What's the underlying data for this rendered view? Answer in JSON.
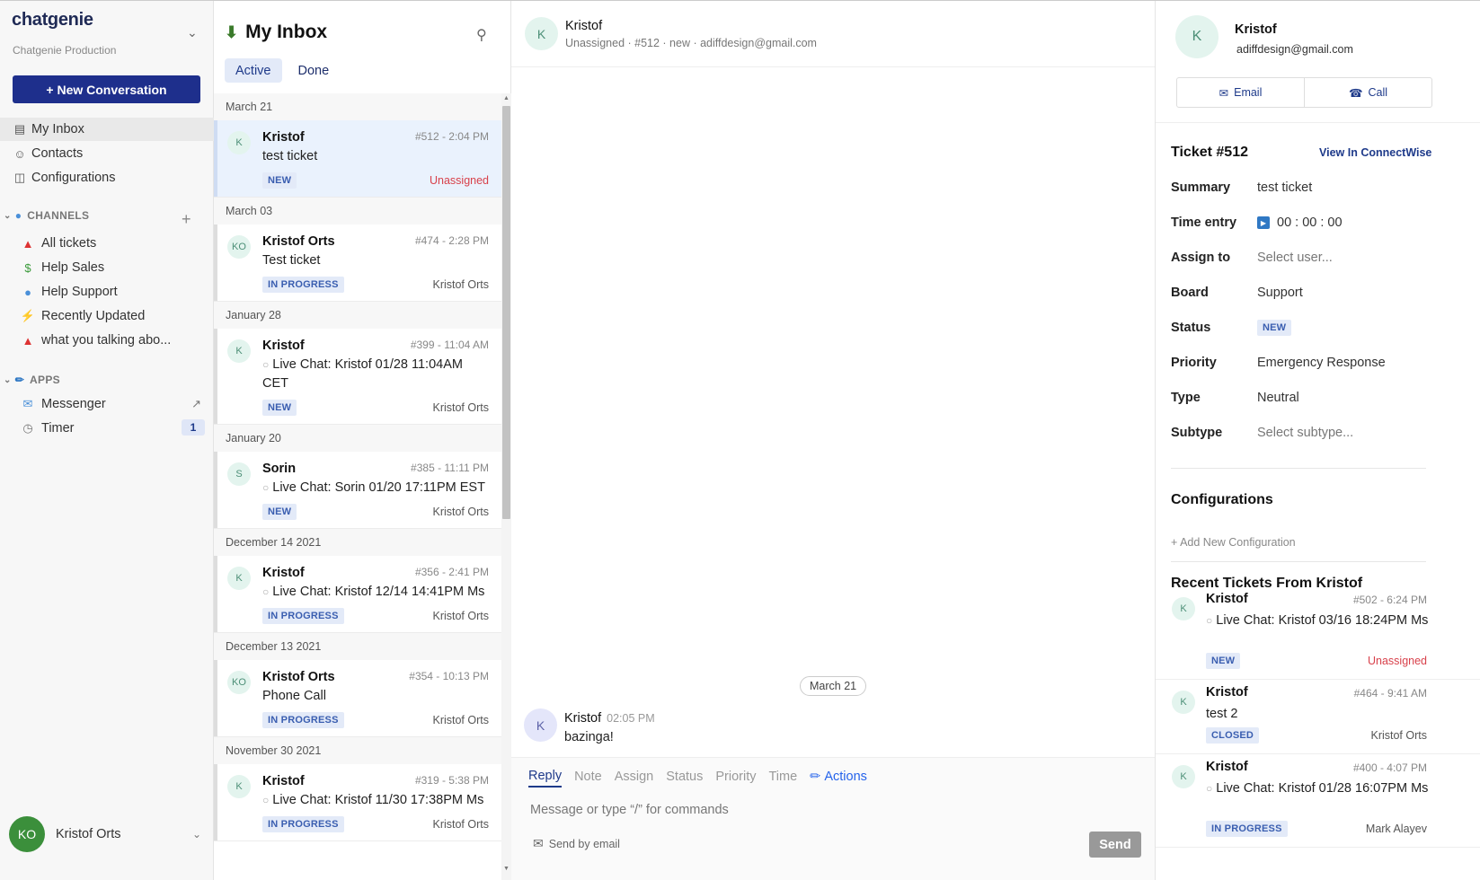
{
  "sidebar": {
    "brand": "chatgenie",
    "workspace": "Chatgenie Production",
    "new_button": "+ New Conversation",
    "nav": [
      {
        "label": "My Inbox",
        "icon": "inbox-icon"
      },
      {
        "label": "Contacts",
        "icon": "contacts-icon"
      },
      {
        "label": "Configurations",
        "icon": "monitor-icon"
      }
    ],
    "channels_header": "CHANNELS",
    "channels": [
      {
        "label": "All tickets",
        "icon": "siren-icon"
      },
      {
        "label": "Help Sales",
        "icon": "money-icon"
      },
      {
        "label": "Help Support",
        "icon": "speech-bubble-icon"
      },
      {
        "label": "Recently Updated",
        "icon": "lightning-icon"
      },
      {
        "label": "what you talking abo...",
        "icon": "siren-icon"
      }
    ],
    "apps_header": "APPS",
    "apps": [
      {
        "label": "Messenger",
        "icon": "messenger-icon"
      },
      {
        "label": "Timer",
        "icon": "clock-icon",
        "badge": "1"
      }
    ],
    "user": {
      "initials": "KO",
      "name": "Kristof Orts"
    }
  },
  "inbox": {
    "title": "My Inbox",
    "tabs": [
      "Active",
      "Done"
    ],
    "groups": [
      {
        "date": "March 21",
        "items": [
          {
            "initials": "K",
            "name": "Kristof",
            "meta": "#512 - 2:04 PM",
            "subject": "test ticket",
            "chat": false,
            "status": "NEW",
            "assignee": "Unassigned",
            "unassigned": true,
            "selected": true
          }
        ]
      },
      {
        "date": "March 03",
        "items": [
          {
            "initials": "KO",
            "name": "Kristof Orts",
            "meta": "#474 - 2:28 PM",
            "subject": "Test ticket",
            "chat": false,
            "status": "IN PROGRESS",
            "assignee": "Kristof Orts"
          }
        ]
      },
      {
        "date": "January 28",
        "items": [
          {
            "initials": "K",
            "name": "Kristof",
            "meta": "#399 - 11:04 AM",
            "subject": "Live Chat: Kristof 01/28 11:04AM CET",
            "chat": true,
            "status": "NEW",
            "assignee": "Kristof Orts"
          }
        ]
      },
      {
        "date": "January 20",
        "items": [
          {
            "initials": "S",
            "name": "Sorin",
            "meta": "#385 - 11:11 PM",
            "subject": "Live Chat: Sorin 01/20 17:11PM EST",
            "chat": true,
            "status": "NEW",
            "assignee": "Kristof Orts"
          }
        ]
      },
      {
        "date": "December 14 2021",
        "items": [
          {
            "initials": "K",
            "name": "Kristof",
            "meta": "#356 - 2:41 PM",
            "subject": "Live Chat: Kristof 12/14 14:41PM Ms",
            "chat": true,
            "status": "IN PROGRESS",
            "assignee": "Kristof Orts"
          }
        ]
      },
      {
        "date": "December 13 2021",
        "items": [
          {
            "initials": "KO",
            "name": "Kristof Orts",
            "meta": "#354 - 10:13 PM",
            "subject": "Phone Call",
            "chat": false,
            "status": "IN PROGRESS",
            "assignee": "Kristof Orts"
          }
        ]
      },
      {
        "date": "November 30 2021",
        "items": [
          {
            "initials": "K",
            "name": "Kristof",
            "meta": "#319 - 5:38 PM",
            "subject": "Live Chat: Kristof 11/30 17:38PM Ms",
            "chat": true,
            "status": "IN PROGRESS",
            "assignee": "Kristof Orts"
          }
        ]
      }
    ]
  },
  "chat": {
    "header_initials": "K",
    "header_name": "Kristof",
    "header_sub": "Unassigned · #512 · new · adiffdesign@gmail.com",
    "date_pill": "March 21",
    "message": {
      "initials": "K",
      "name": "Kristof",
      "time": "02:05 PM",
      "text": "bazinga!"
    },
    "composer_tabs": [
      "Reply",
      "Note",
      "Assign",
      "Status",
      "Priority",
      "Time"
    ],
    "actions_label": "Actions",
    "placeholder": "Message or type “/” for commands",
    "send_by_email": "Send by email",
    "send": "Send"
  },
  "details": {
    "initials": "K",
    "name": "Kristof",
    "email": "adiffdesign@gmail.com",
    "email_btn": "Email",
    "call_btn": "Call",
    "ticket_title": "Ticket #512",
    "view_link": "View In ConnectWise",
    "fields": {
      "summary": {
        "label": "Summary",
        "value": "test ticket"
      },
      "time_entry": {
        "label": "Time entry",
        "value": "00 : 00 : 00"
      },
      "assign_to": {
        "label": "Assign to",
        "value": "Select user..."
      },
      "board": {
        "label": "Board",
        "value": "Support"
      },
      "status": {
        "label": "Status",
        "value": "NEW"
      },
      "priority": {
        "label": "Priority",
        "value": "Emergency Response"
      },
      "type": {
        "label": "Type",
        "value": "Neutral"
      },
      "subtype": {
        "label": "Subtype",
        "value": "Select subtype..."
      }
    },
    "configurations_title": "Configurations",
    "add_config": "+ Add New Configuration",
    "recent_title": "Recent Tickets From Kristof",
    "recent": [
      {
        "initials": "K",
        "name": "Kristof",
        "meta": "#502 - 6:24 PM",
        "subject": "Live Chat: Kristof 03/16 18:24PM Ms",
        "chat": true,
        "status": "NEW",
        "assignee": "Unassigned",
        "unassigned": true
      },
      {
        "initials": "K",
        "name": "Kristof",
        "meta": "#464 - 9:41 AM",
        "subject": "test 2",
        "chat": false,
        "status": "CLOSED",
        "assignee": "Kristof Orts"
      },
      {
        "initials": "K",
        "name": "Kristof",
        "meta": "#400 - 4:07 PM",
        "subject": "Live Chat: Kristof 01/28 16:07PM Ms",
        "chat": true,
        "status": "IN PROGRESS",
        "assignee": "Mark Alayev"
      }
    ]
  }
}
